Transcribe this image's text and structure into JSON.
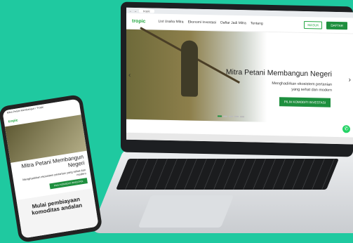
{
  "laptop": {
    "browser": {
      "url": "tropic"
    },
    "site": {
      "logo": "tropic",
      "nav": [
        "List Usaha Mitra",
        "Ekonomi Investasi",
        "Daftar Jadi Mitra",
        "Tentang"
      ],
      "login": "MASUK",
      "register": "DAFTAR"
    },
    "hero": {
      "title": "Mitra Petani Membangun Negeri",
      "subtitle": "Menghadirkan ekosistem pertanian yang sehat dan modern",
      "cta": "PILIH KOMODITI INVESTASI",
      "prev": "‹",
      "next": "›"
    },
    "whatsapp_icon": "whatsapp-icon"
  },
  "phone": {
    "statusbar": "Mitra Petani Membangun / Tropic",
    "logo": "tropic",
    "hero_title": "Mitra Petani Membangun Negeri",
    "hero_subtitle": "Menghadirkan ekosistem pertanian yang sehat dan modern",
    "cta": "PILIH KOMODITI INVESTASI",
    "bottom_title": "Mulai pembiayaan komoditas andalan"
  },
  "colors": {
    "background": "#1fc9a0",
    "brand": "#1e8f3e"
  }
}
